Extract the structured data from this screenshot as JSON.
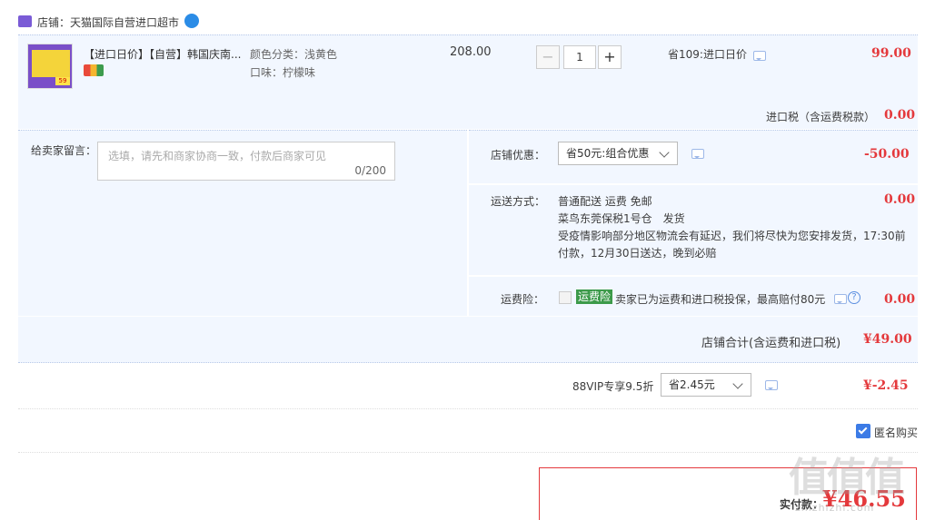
{
  "shop": {
    "prefix": "店铺：",
    "name": "天猫国际自营进口超市"
  },
  "product": {
    "title": "【进口日价】【自营】韩国庆南...",
    "color_label": "颜色分类：浅黄色",
    "flavor_label": "口味：柠檬味",
    "unit_price": "208.00",
    "quantity": "1",
    "minus": "−",
    "plus": "+",
    "discount_text": "省109:进口日价",
    "subtotal": "99.00",
    "pkg_text": "59"
  },
  "tax": {
    "label": "进口税（含运费税款）",
    "value": "0.00"
  },
  "message": {
    "label": "给卖家留言：",
    "placeholder": "选填，请先和商家协商一致，付款后商家可见",
    "counter": "0/200"
  },
  "shop_discount": {
    "label": "店铺优惠：",
    "selected": "省50元:组合优惠",
    "value": "-50.00"
  },
  "shipping": {
    "label": "运送方式：",
    "line1": "普通配送 运费 免邮",
    "line2": "菜鸟东莞保税1号仓　发货",
    "line3": "受疫情影响部分地区物流会有延迟，我们将尽快为您安排发货，17:30前",
    "line4": "付款，12月30日送达，晚到必赔",
    "value": "0.00"
  },
  "insurance": {
    "label": "运费险：",
    "badge": "运费险",
    "text": "卖家已为运费和进口税投保，最高赔付80元",
    "help": "?",
    "value": "0.00"
  },
  "shop_total": {
    "label": "店铺合计(含运费和进口税)",
    "value": "¥49.00"
  },
  "vip": {
    "label": "88VIP专享9.5折",
    "selected": "省2.45元",
    "value": "¥-2.45"
  },
  "anonymous": {
    "label": "匿名购买"
  },
  "payment": {
    "label": "实付款：",
    "value": "¥46.55"
  },
  "watermark": {
    "big": "值值值",
    "small": "zhizhizhi.com"
  },
  "colors": {
    "accent_red": "#e4393c",
    "panel_bg": "#f2f7ff",
    "check_blue": "#3c7be6",
    "badge_green": "#3c9a4a"
  }
}
